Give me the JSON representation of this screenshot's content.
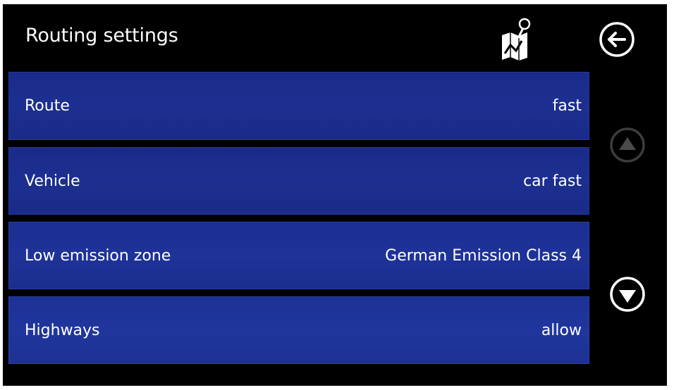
{
  "header": {
    "title": "Routing settings",
    "map_icon": "map-pin-icon",
    "back_icon": "back-arrow-icon"
  },
  "settings": [
    {
      "label": "Route",
      "value": "fast"
    },
    {
      "label": "Vehicle",
      "value": "car fast"
    },
    {
      "label": "Low emission zone",
      "value": "German Emission Class 4"
    },
    {
      "label": "Highways",
      "value": "allow"
    }
  ],
  "scroll": {
    "up_icon": "scroll-up-icon",
    "up_enabled": false,
    "down_icon": "scroll-down-icon",
    "down_enabled": true
  },
  "colors": {
    "background": "#000000",
    "row": "#1c2f90",
    "text": "#ffffff",
    "disabled": "#4a4a4a"
  }
}
